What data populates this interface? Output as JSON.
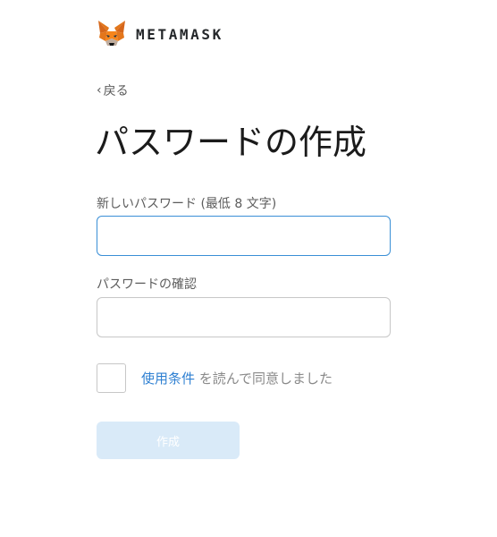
{
  "brand": {
    "name": "METAMASK",
    "logo_icon": "metamask-fox-icon"
  },
  "nav": {
    "back_icon": "chevron-left-icon",
    "back_label": "戻る"
  },
  "form": {
    "title": "パスワードの作成",
    "new_password": {
      "label": "新しいパスワード (最低 8 文字)",
      "value": "",
      "placeholder": ""
    },
    "confirm_password": {
      "label": "パスワードの確認",
      "value": "",
      "placeholder": ""
    },
    "terms": {
      "checked": false,
      "link_text": "使用条件",
      "suffix_text": " を読んで同意しました"
    },
    "submit_label": "作成",
    "submit_enabled": false
  },
  "colors": {
    "link": "#2f80d2",
    "focus_border": "#3a8fd6",
    "button_disabled_bg": "#d9eaf8",
    "fox_orange": "#e2761b"
  }
}
